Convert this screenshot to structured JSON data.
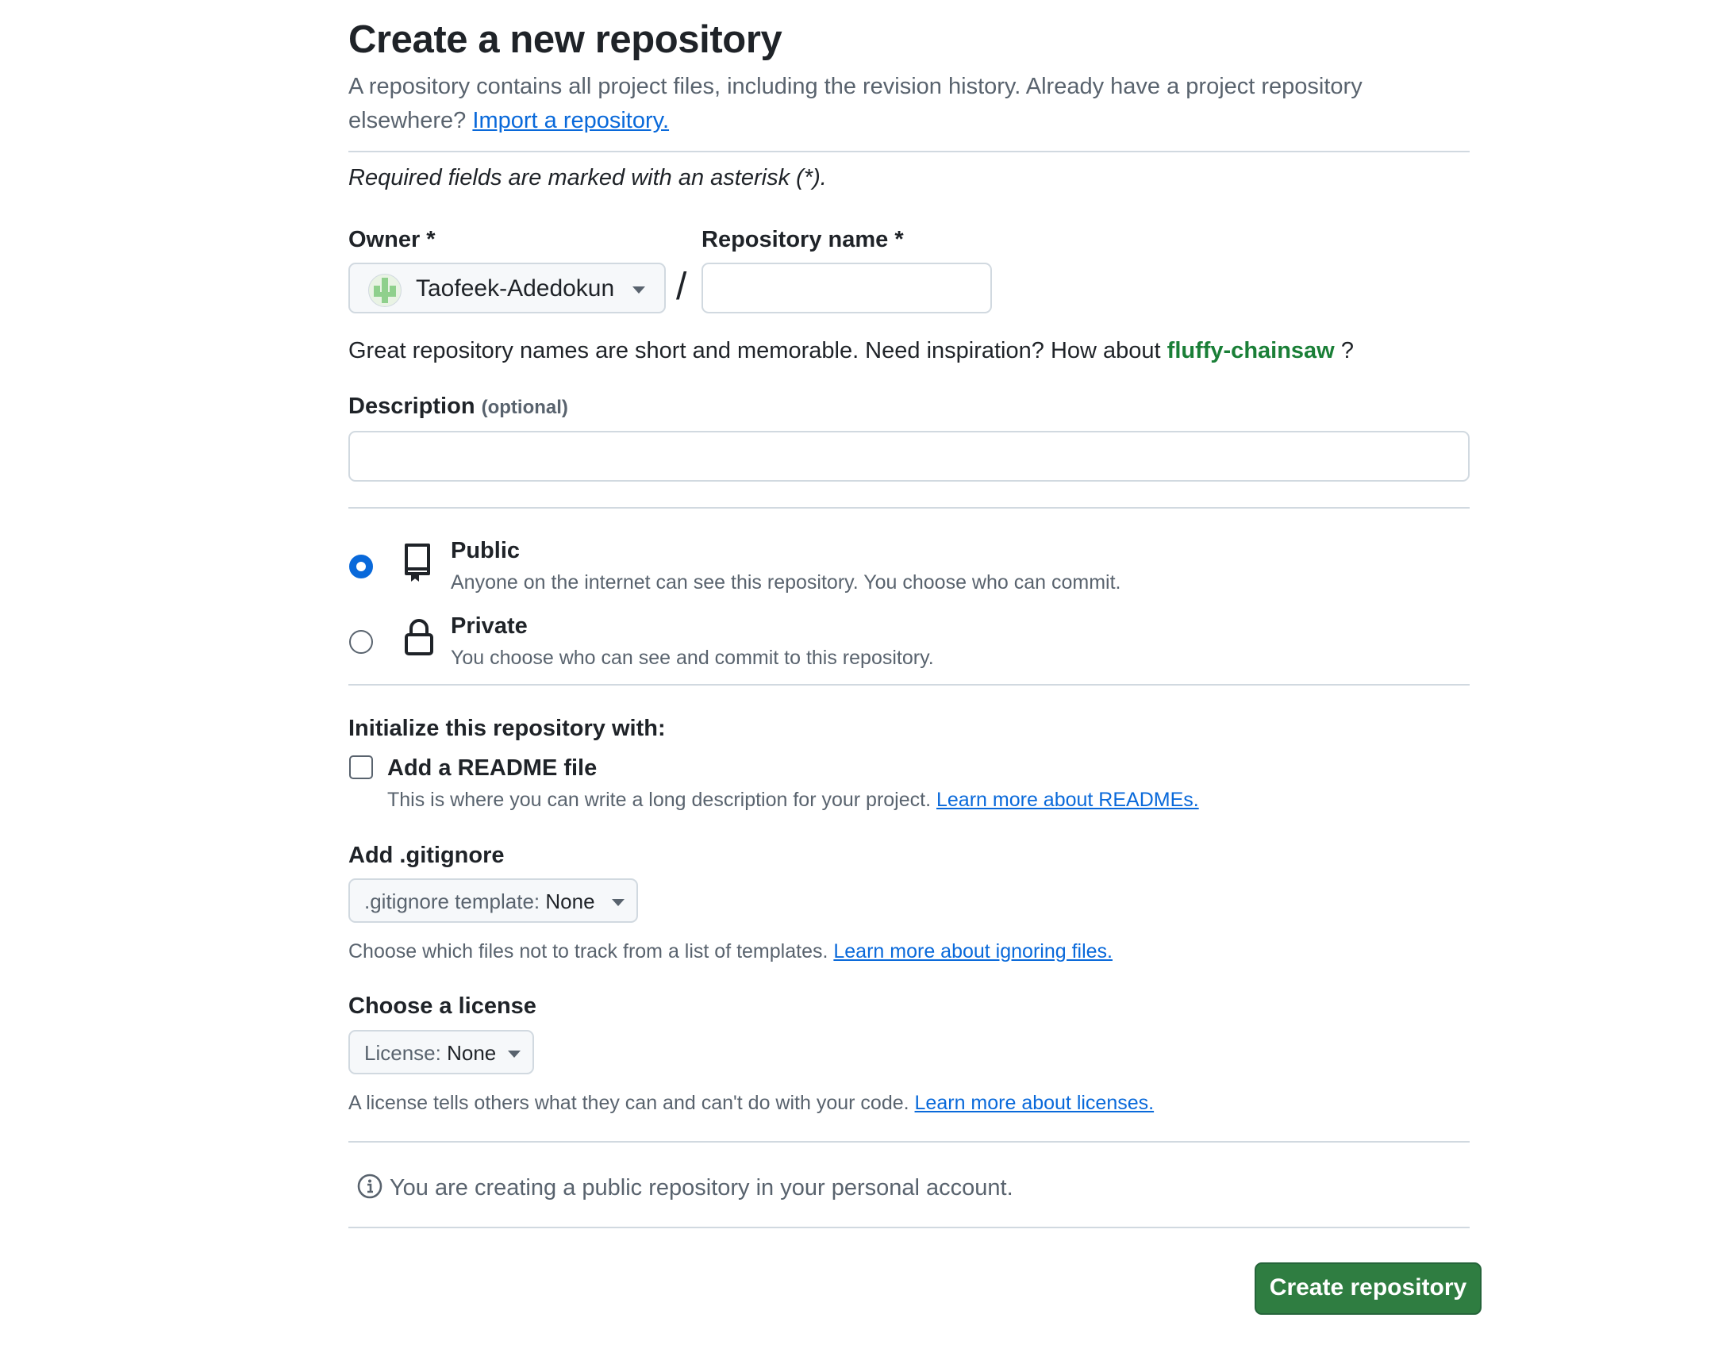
{
  "page": {
    "title": "Create a new repository",
    "subtitle": "A repository contains all project files, including the revision history. Already have a project repository elsewhere?",
    "import_link": "Import a repository.",
    "required_note": "Required fields are marked with an asterisk (*)."
  },
  "owner": {
    "label": "Owner *",
    "value": "Taofeek-Adedokun"
  },
  "separator": "/",
  "repo_name": {
    "label": "Repository name *",
    "value": "",
    "placeholder": ""
  },
  "name_hint": {
    "text": "Great repository names are short and memorable. Need inspiration? How about",
    "suggestion": "fluffy-chainsaw",
    "suffix": "?"
  },
  "description": {
    "label": "Description",
    "optional": "(optional)",
    "value": "",
    "placeholder": ""
  },
  "visibility": {
    "selected": "public",
    "options": [
      {
        "id": "public",
        "title": "Public",
        "desc": "Anyone on the internet can see this repository. You choose who can commit."
      },
      {
        "id": "private",
        "title": "Private",
        "desc": "You choose who can see and commit to this repository."
      }
    ]
  },
  "init": {
    "heading": "Initialize this repository with:",
    "readme_label": "Add a README file",
    "readme_checked": false,
    "readme_desc": "This is where you can write a long description for your project.",
    "readme_link": "Learn more about READMEs."
  },
  "gitignore": {
    "heading": "Add .gitignore",
    "select_key": ".gitignore template:",
    "select_value": "None",
    "desc": "Choose which files not to track from a list of templates.",
    "link": "Learn more about ignoring files."
  },
  "license": {
    "heading": "Choose a license",
    "select_key": "License:",
    "select_value": "None",
    "desc": "A license tells others what they can and can't do with your code.",
    "link": "Learn more about licenses."
  },
  "notice": "You are creating a public repository in your personal account.",
  "submit_label": "Create repository",
  "colors": {
    "primary_button": "#2f7d41",
    "link": "#0969da",
    "suggestion": "#1a7f37",
    "radio_selected": "#0969da"
  },
  "icons": {
    "public": "repo-icon",
    "private": "lock-icon",
    "notice": "info-icon",
    "owner_avatar": "avatar"
  }
}
